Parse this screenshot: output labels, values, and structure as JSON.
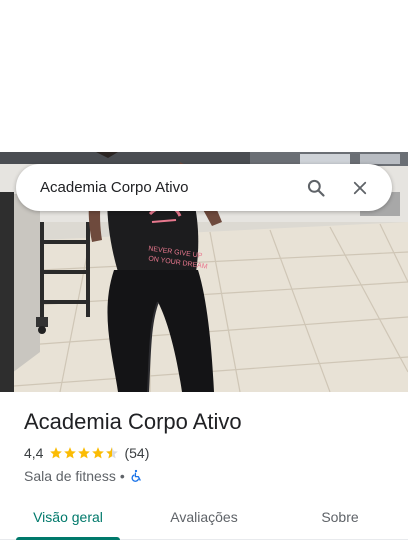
{
  "search": {
    "query": "Academia Corpo Ativo",
    "search_icon": "search-icon",
    "clear_icon": "close-icon"
  },
  "photo": {
    "shirt_text_1": "NEVER GIVE UP",
    "shirt_text_2": "ON YOUR DREAM"
  },
  "place": {
    "name": "Academia Corpo Ativo",
    "rating": "4,4",
    "rating_value": 4.4,
    "reviews": "(54)",
    "category": "Sala de fitness",
    "separator": "•",
    "accessibility_icon": "wheelchair-icon"
  },
  "tabs": [
    {
      "label": "Visão geral",
      "active": true
    },
    {
      "label": "Avaliações",
      "active": false
    },
    {
      "label": "Sobre",
      "active": false
    }
  ],
  "colors": {
    "accent": "#00796b",
    "star": "#fbbc04",
    "accessibility": "#1a73e8"
  }
}
